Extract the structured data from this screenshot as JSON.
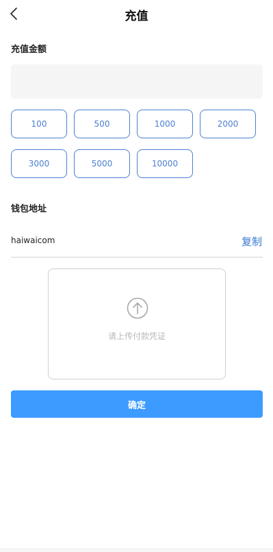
{
  "header": {
    "title": "充值",
    "back_icon": "chevron-left-icon"
  },
  "amount": {
    "label": "充值金额",
    "input_value": "",
    "placeholder": "",
    "options": [
      "100",
      "500",
      "1000",
      "2000",
      "3000",
      "5000",
      "10000"
    ]
  },
  "wallet": {
    "label": "钱包地址",
    "address": "haiwaicom",
    "copy_label": "复制"
  },
  "upload": {
    "icon": "upload-arrow-icon",
    "hint": "请上传付款凭证"
  },
  "actions": {
    "confirm_label": "确定"
  },
  "colors": {
    "accent": "#3d9bff",
    "chip_border": "#4a7fd0",
    "link": "#3a78d0"
  }
}
